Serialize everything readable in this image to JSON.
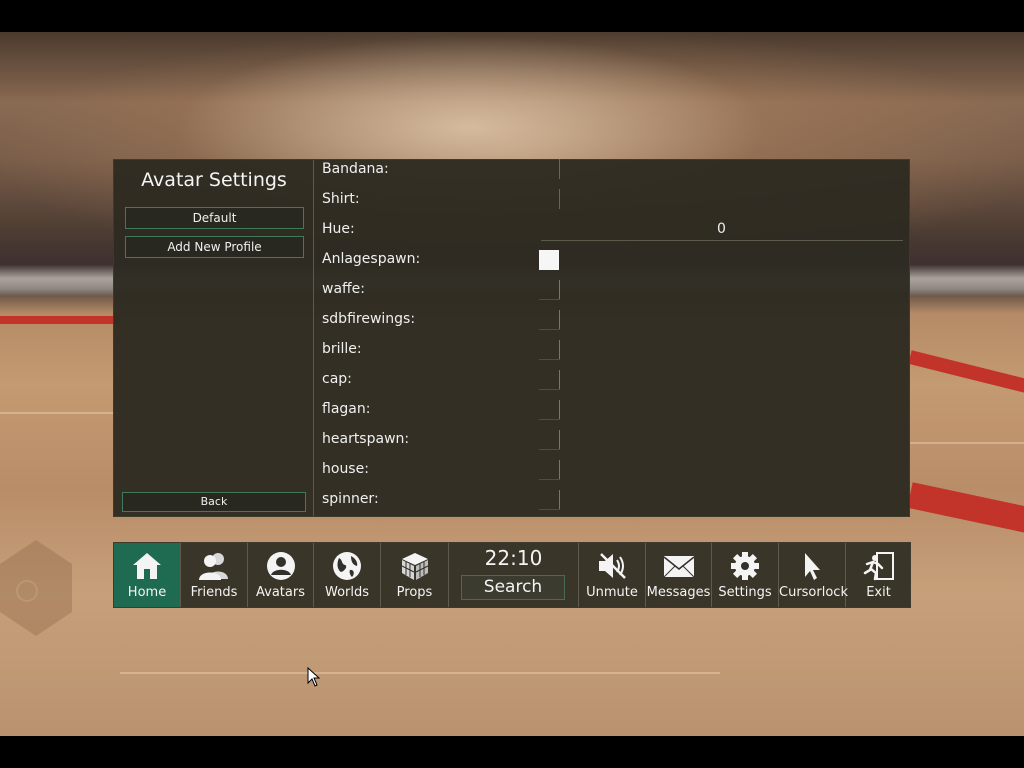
{
  "panel": {
    "title": "Avatar Settings",
    "profiles": [
      "Default",
      "Add New Profile"
    ],
    "back_label": "Back",
    "settings": [
      {
        "label": "Bandana:",
        "type": "dropdown"
      },
      {
        "label": "Shirt:",
        "type": "dropdown"
      },
      {
        "label": "Hue:",
        "type": "slider",
        "value": "0"
      },
      {
        "label": "Anlagespawn:",
        "type": "checkbox",
        "checked": true
      },
      {
        "label": "waffe:",
        "type": "checkbox",
        "checked": false
      },
      {
        "label": "sdbfirewings:",
        "type": "checkbox",
        "checked": false
      },
      {
        "label": "brille:",
        "type": "checkbox",
        "checked": false
      },
      {
        "label": "cap:",
        "type": "checkbox",
        "checked": false
      },
      {
        "label": "flagan:",
        "type": "checkbox",
        "checked": false
      },
      {
        "label": "heartspawn:",
        "type": "checkbox",
        "checked": false
      },
      {
        "label": "house:",
        "type": "checkbox",
        "checked": false
      },
      {
        "label": "spinner:",
        "type": "checkbox",
        "checked": false
      }
    ]
  },
  "menu": {
    "items_left": [
      {
        "id": "home",
        "label": "Home",
        "icon": "home-icon",
        "active": true
      },
      {
        "id": "friends",
        "label": "Friends",
        "icon": "friends-icon",
        "active": false
      },
      {
        "id": "avatars",
        "label": "Avatars",
        "icon": "avatar-icon",
        "active": false
      },
      {
        "id": "worlds",
        "label": "Worlds",
        "icon": "globe-icon",
        "active": false
      },
      {
        "id": "props",
        "label": "Props",
        "icon": "cube-icon",
        "active": false
      }
    ],
    "clock": "22:10",
    "search_label": "Search",
    "items_right": [
      {
        "id": "unmute",
        "label": "Unmute",
        "icon": "speaker-muted-icon",
        "active": false
      },
      {
        "id": "messages",
        "label": "Messages",
        "icon": "envelope-icon",
        "active": false
      },
      {
        "id": "settings",
        "label": "Settings",
        "icon": "gear-icon",
        "active": false
      },
      {
        "id": "cursorlock",
        "label": "Cursorlock",
        "icon": "cursor-icon",
        "active": false
      },
      {
        "id": "exit",
        "label": "Exit",
        "icon": "exit-icon",
        "active": false
      }
    ]
  },
  "colors": {
    "panel_bg": "#2e2b21",
    "active_button": "#1f6b52",
    "button_border": "#3f7a5a",
    "text": "#f0f0f0"
  }
}
